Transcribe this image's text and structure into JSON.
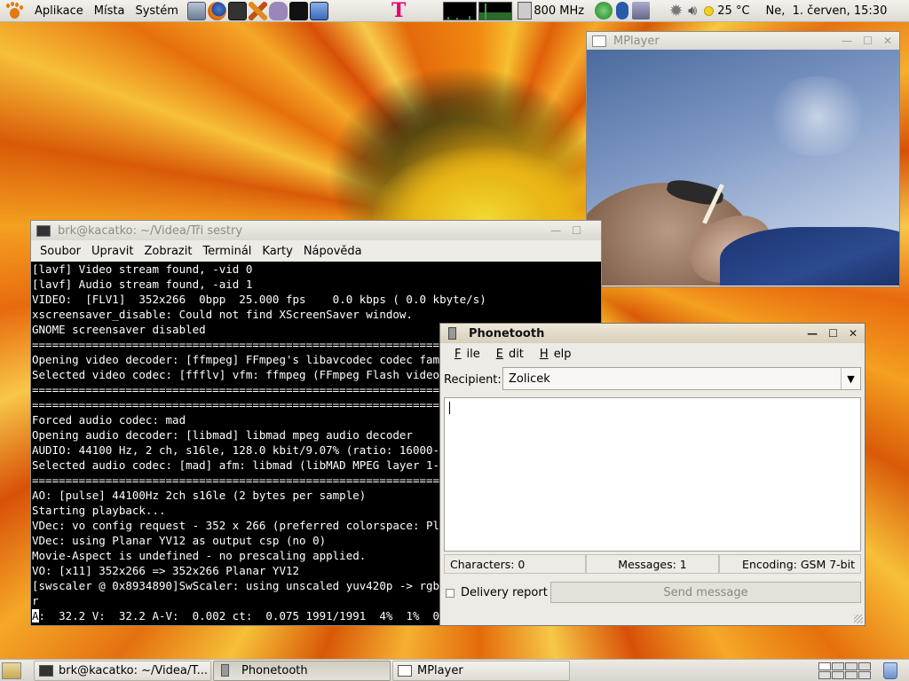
{
  "top_panel": {
    "menus": [
      "Aplikace",
      "Místa",
      "Systém"
    ],
    "cpu_freq": "800 MHz",
    "weather": "25 °C",
    "clock": "Ne,  1. červen, 15:30"
  },
  "terminal": {
    "title": "brk@kacatko: ~/Videa/Tři sestry",
    "menus": [
      "Soubor",
      "Upravit",
      "Zobrazit",
      "Terminál",
      "Karty",
      "Nápověda"
    ],
    "lines": [
      "[lavf] Video stream found, -vid 0",
      "[lavf] Audio stream found, -aid 1",
      "VIDEO:  [FLV1]  352x266  0bpp  25.000 fps    0.0 kbps ( 0.0 kbyte/s)",
      "xscreensaver_disable: Could not find XScreenSaver window.",
      "GNOME screensaver disabled",
      "==========================================================================",
      "Opening video decoder: [ffmpeg] FFmpeg's libavcodec codec family",
      "Selected video codec: [ffflv] vfm: ffmpeg (FFmpeg Flash video)",
      "==========================================================================",
      "==========================================================================",
      "Forced audio codec: mad",
      "Opening audio decoder: [libmad] libmad mpeg audio decoder",
      "AUDIO: 44100 Hz, 2 ch, s16le, 128.0 kbit/9.07% (ratio: 16000->176400)",
      "Selected audio codec: [mad] afm: libmad (libMAD MPEG layer 1-2-3)",
      "==========================================================================",
      "AO: [pulse] 44100Hz 2ch s16le (2 bytes per sample)",
      "Starting playback...",
      "VDec: vo config request - 352 x 266 (preferred colorspace: Planar YV12)",
      "VDec: using Planar YV12 as output csp (no 0)",
      "Movie-Aspect is undefined - no prescaling applied.",
      "VO: [x11] 352x266 => 352x266 Planar YV12",
      "[swscaler @ 0x8934890]SwScaler: using unscaled yuv420p -> rgb32 special converter",
      "r"
    ],
    "status_line_cursor": "A",
    "status_line_rest": ":  32.2 V:  32.2 A-V:  0.002 ct:  0.075 1991/1991  4%  1%  0.5% 0 0"
  },
  "mplayer": {
    "title": "MPlayer"
  },
  "phonetooth": {
    "title": "Phonetooth",
    "menus": [
      "File",
      "Edit",
      "Help"
    ],
    "recipient_label": "Recipient:",
    "recipient_value": "Zolicek",
    "characters": "Characters: 0",
    "messages": "Messages: 1",
    "encoding": "Encoding: GSM 7-bit",
    "delivery_report": "Delivery report",
    "send_button": "Send message"
  },
  "taskbar": {
    "items": [
      "brk@kacatko: ~/Videa/T...",
      "Phonetooth",
      "MPlayer"
    ]
  },
  "colors": {
    "panel": "#dedbd3",
    "tmobile": "#e20074",
    "terminal_bg": "#000000"
  }
}
